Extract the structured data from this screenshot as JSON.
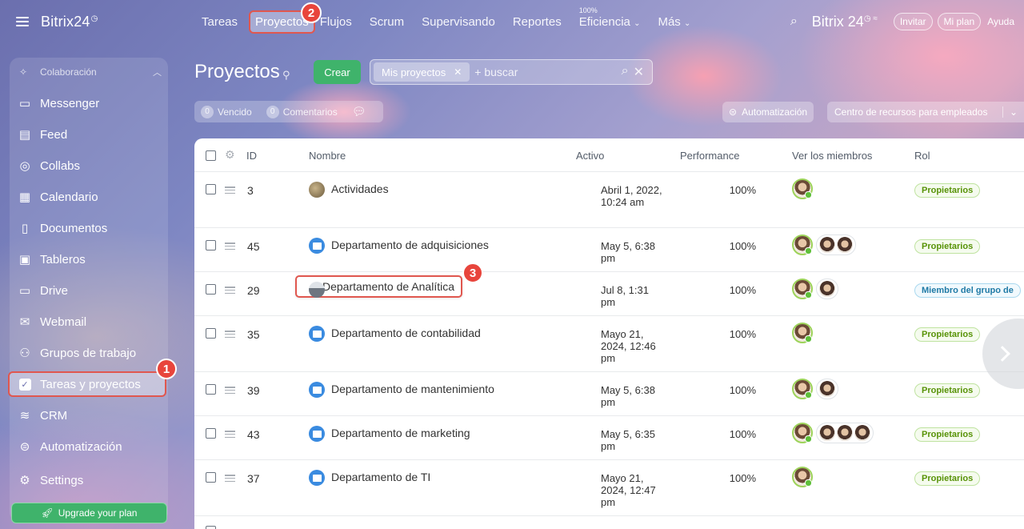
{
  "app": {
    "logo": "Bitrix24",
    "logo_right": "Bitrix 24"
  },
  "sidebar": {
    "section": "Colaboración",
    "items": [
      {
        "label": "Messenger",
        "icon": "chat-icon"
      },
      {
        "label": "Feed",
        "icon": "feed-icon"
      },
      {
        "label": "Collabs",
        "icon": "collabs-icon"
      },
      {
        "label": "Calendario",
        "icon": "calendar-icon"
      },
      {
        "label": "Documentos",
        "icon": "document-icon"
      },
      {
        "label": "Tableros",
        "icon": "board-icon"
      },
      {
        "label": "Drive",
        "icon": "drive-icon"
      },
      {
        "label": "Webmail",
        "icon": "mail-icon"
      },
      {
        "label": "Grupos de trabajo",
        "icon": "group-icon"
      },
      {
        "label": "Tareas y proyectos",
        "icon": "task-check-icon",
        "active": true
      },
      {
        "label": "CRM",
        "icon": "crm-icon"
      },
      {
        "label": "Automatización",
        "icon": "robot-icon"
      },
      {
        "label": "Settings",
        "icon": "gear-icon"
      }
    ],
    "upgrade": "Upgrade your plan"
  },
  "topnav": {
    "items": [
      "Tareas",
      "Proyectos",
      "Flujos",
      "Scrum",
      "Supervisando",
      "Reportes",
      "Eficiencia",
      "Más"
    ],
    "efficiency_value": "100%",
    "invite": "Invitar",
    "my_plan": "Mi plan",
    "help": "Ayuda"
  },
  "page": {
    "title": "Proyectos",
    "create": "Crear",
    "filter_chip": "Mis proyectos",
    "search_placeholder": "+ buscar",
    "overdue_count": "0",
    "overdue": "Vencido",
    "comments_count": "0",
    "comments": "Comentarios",
    "automation": "Automatización",
    "resource_center": "Centro de recursos para empleados"
  },
  "table": {
    "headers": {
      "id": "ID",
      "name": "Nombre",
      "active": "Activo",
      "performance": "Performance",
      "members": "Ver los miembros",
      "role": "Rol"
    },
    "rows": [
      {
        "id": "3",
        "name": "Actividades",
        "active": "Abril 1, 2022, 10:24 am",
        "perf": "100%",
        "role": "Propietarios",
        "extra_members": 0
      },
      {
        "id": "45",
        "name": "Departamento de adquisiciones",
        "active": "May 5, 6:38 pm",
        "perf": "100%",
        "role": "Propietarios",
        "extra_members": 2
      },
      {
        "id": "29",
        "name": "Departamento de Analítica",
        "active": "Jul 8, 1:31 pm",
        "perf": "100%",
        "role": "Miembro del grupo de",
        "extra_members": 1
      },
      {
        "id": "35",
        "name": "Departamento de contabilidad",
        "active": "Mayo 21, 2024, 12:46 pm",
        "perf": "100%",
        "role": "Propietarios",
        "extra_members": 0
      },
      {
        "id": "39",
        "name": "Departamento de mantenimiento",
        "active": "May 5, 6:38 pm",
        "perf": "100%",
        "role": "Propietarios",
        "extra_members": 1
      },
      {
        "id": "43",
        "name": "Departamento de marketing",
        "active": "May 5, 6:35 pm",
        "perf": "100%",
        "role": "Propietarios",
        "extra_members": 3
      },
      {
        "id": "37",
        "name": "Departamento de TI",
        "active": "Mayo 21, 2024, 12:47 pm",
        "perf": "100%",
        "role": "Propietarios",
        "extra_members": 0
      }
    ]
  },
  "annotations": [
    "1",
    "2",
    "3"
  ],
  "colors": {
    "accent_green": "#3fb36b",
    "highlight_red": "#e0574f",
    "role_green": "#589308"
  }
}
